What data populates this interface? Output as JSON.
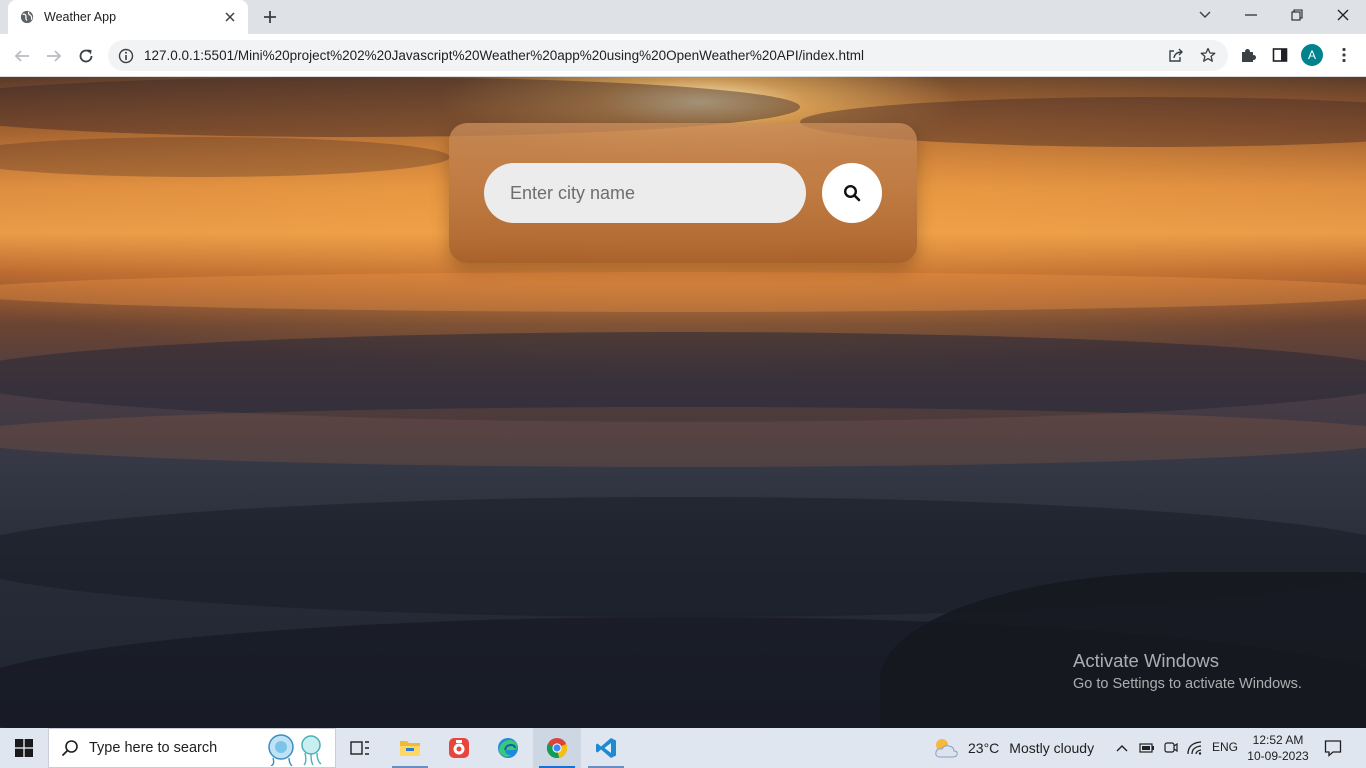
{
  "browser": {
    "tab_title": "Weather App",
    "url": "127.0.0.1:5501/Mini%20project%202%20Javascript%20Weather%20app%20using%20OpenWeather%20API/index.html",
    "profile_initial": "A",
    "icons": [
      "globe-icon",
      "close-icon",
      "plus-icon",
      "chevron-down-icon",
      "minimize-icon",
      "restore-icon",
      "window-close-icon",
      "back-arrow-icon",
      "forward-arrow-icon",
      "reload-icon",
      "info-icon",
      "share-icon",
      "star-icon",
      "puzzle-icon",
      "sidebar-icon",
      "more-vert-icon"
    ]
  },
  "app": {
    "search_placeholder": "Enter city name",
    "search_value": "",
    "search_icon": "search-icon"
  },
  "watermark": {
    "line1": "Activate Windows",
    "line2": "Go to Settings to activate Windows."
  },
  "taskbar": {
    "search_placeholder": "Type here to search",
    "weather_temp": "23°C",
    "weather_condition": "Mostly cloudy",
    "language": "ENG",
    "time": "12:52 AM",
    "date": "10-09-2023",
    "apps": [
      "task-view",
      "file-explorer",
      "recorder",
      "edge",
      "chrome",
      "vscode"
    ]
  },
  "colors": {
    "accent": "#1f6fd1",
    "card": "#a5612e",
    "avatar": "#00838f"
  }
}
